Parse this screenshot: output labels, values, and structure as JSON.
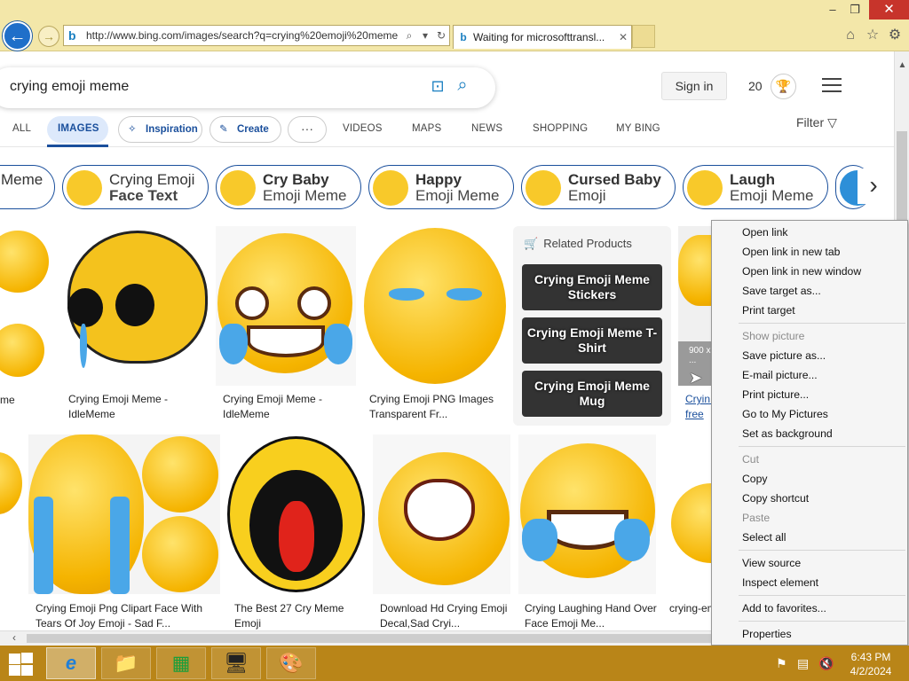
{
  "window": {
    "min": "–",
    "max": "❐",
    "close": "✕"
  },
  "address_bar": {
    "url": "http://www.bing.com/images/search?q=crying%20emoji%20meme"
  },
  "tab": {
    "label": "Waiting for microsofttransl...",
    "close": "✕"
  },
  "search": {
    "query": "crying emoji meme"
  },
  "header": {
    "signin": "Sign in",
    "points": "20"
  },
  "nav": {
    "all": "ALL",
    "images": "IMAGES",
    "inspiration": "Inspiration",
    "create": "Create",
    "more": "···",
    "videos": "VIDEOS",
    "maps": "MAPS",
    "news": "NEWS",
    "shopping": "SHOPPING",
    "mybing": "MY BING",
    "filter": "Filter"
  },
  "chips": [
    {
      "l1": "",
      "l2": "Meme"
    },
    {
      "l1": "Crying Emoji",
      "l2": "Face Text"
    },
    {
      "l1": "Cry Baby",
      "l2": "Emoji Meme"
    },
    {
      "l1": "Happy",
      "l2": "Emoji Meme"
    },
    {
      "l1": "Cursed Baby",
      "l2": "Emoji"
    },
    {
      "l1": "Laugh",
      "l2": "Emoji Meme"
    }
  ],
  "results_row1": [
    {
      "caption": "me"
    },
    {
      "caption": "Crying Emoji Meme - IdleMeme"
    },
    {
      "caption": "Crying Emoji Meme - IdleMeme"
    },
    {
      "caption": "Crying Emoji PNG Images Transparent Fr..."
    },
    {
      "caption": "Cryin... free t..."
    }
  ],
  "related": {
    "header": "Related Products",
    "items": [
      "Crying Emoji Meme Stickers",
      "Crying Emoji Meme T-Shirt",
      "Crying Emoji Meme Mug"
    ]
  },
  "results_row2": [
    {
      "caption": "Crying Emoji Png Clipart Face With Tears Of Joy Emoji - Sad F..."
    },
    {
      "caption": "The Best 27 Cry Meme Emoji"
    },
    {
      "caption": "Download Hd Crying Emoji Decal,Sad Cryi..."
    },
    {
      "caption": "Crying Laughing Hand Over Face Emoji Me..."
    },
    {
      "caption": "crying-em..."
    }
  ],
  "img_overlay": "900 x ...",
  "context_menu": [
    {
      "label": "Open link",
      "disabled": false
    },
    {
      "label": "Open link in new tab",
      "disabled": false
    },
    {
      "label": "Open link in new window",
      "disabled": false
    },
    {
      "label": "Save target as...",
      "disabled": false
    },
    {
      "label": "Print target",
      "disabled": false
    },
    {
      "label": "Show picture",
      "disabled": true
    },
    {
      "label": "Save picture as...",
      "disabled": false
    },
    {
      "label": "E-mail picture...",
      "disabled": false
    },
    {
      "label": "Print picture...",
      "disabled": false
    },
    {
      "label": "Go to My Pictures",
      "disabled": false
    },
    {
      "label": "Set as background",
      "disabled": false
    },
    {
      "label": "Cut",
      "disabled": true
    },
    {
      "label": "Copy",
      "disabled": false
    },
    {
      "label": "Copy shortcut",
      "disabled": false
    },
    {
      "label": "Paste",
      "disabled": true
    },
    {
      "label": "Select all",
      "disabled": false
    },
    {
      "label": "View source",
      "disabled": false
    },
    {
      "label": "Inspect element",
      "disabled": false
    },
    {
      "label": "Add to favorites...",
      "disabled": false
    },
    {
      "label": "Properties",
      "disabled": false
    }
  ],
  "taskbar": {
    "time": "6:43 PM",
    "date": "4/2/2024"
  },
  "colors": {
    "ie_frame": "#f3e7a9",
    "bing_blue": "#1a4f9c",
    "taskbar": "#b98518",
    "close_red": "#c7342b"
  }
}
